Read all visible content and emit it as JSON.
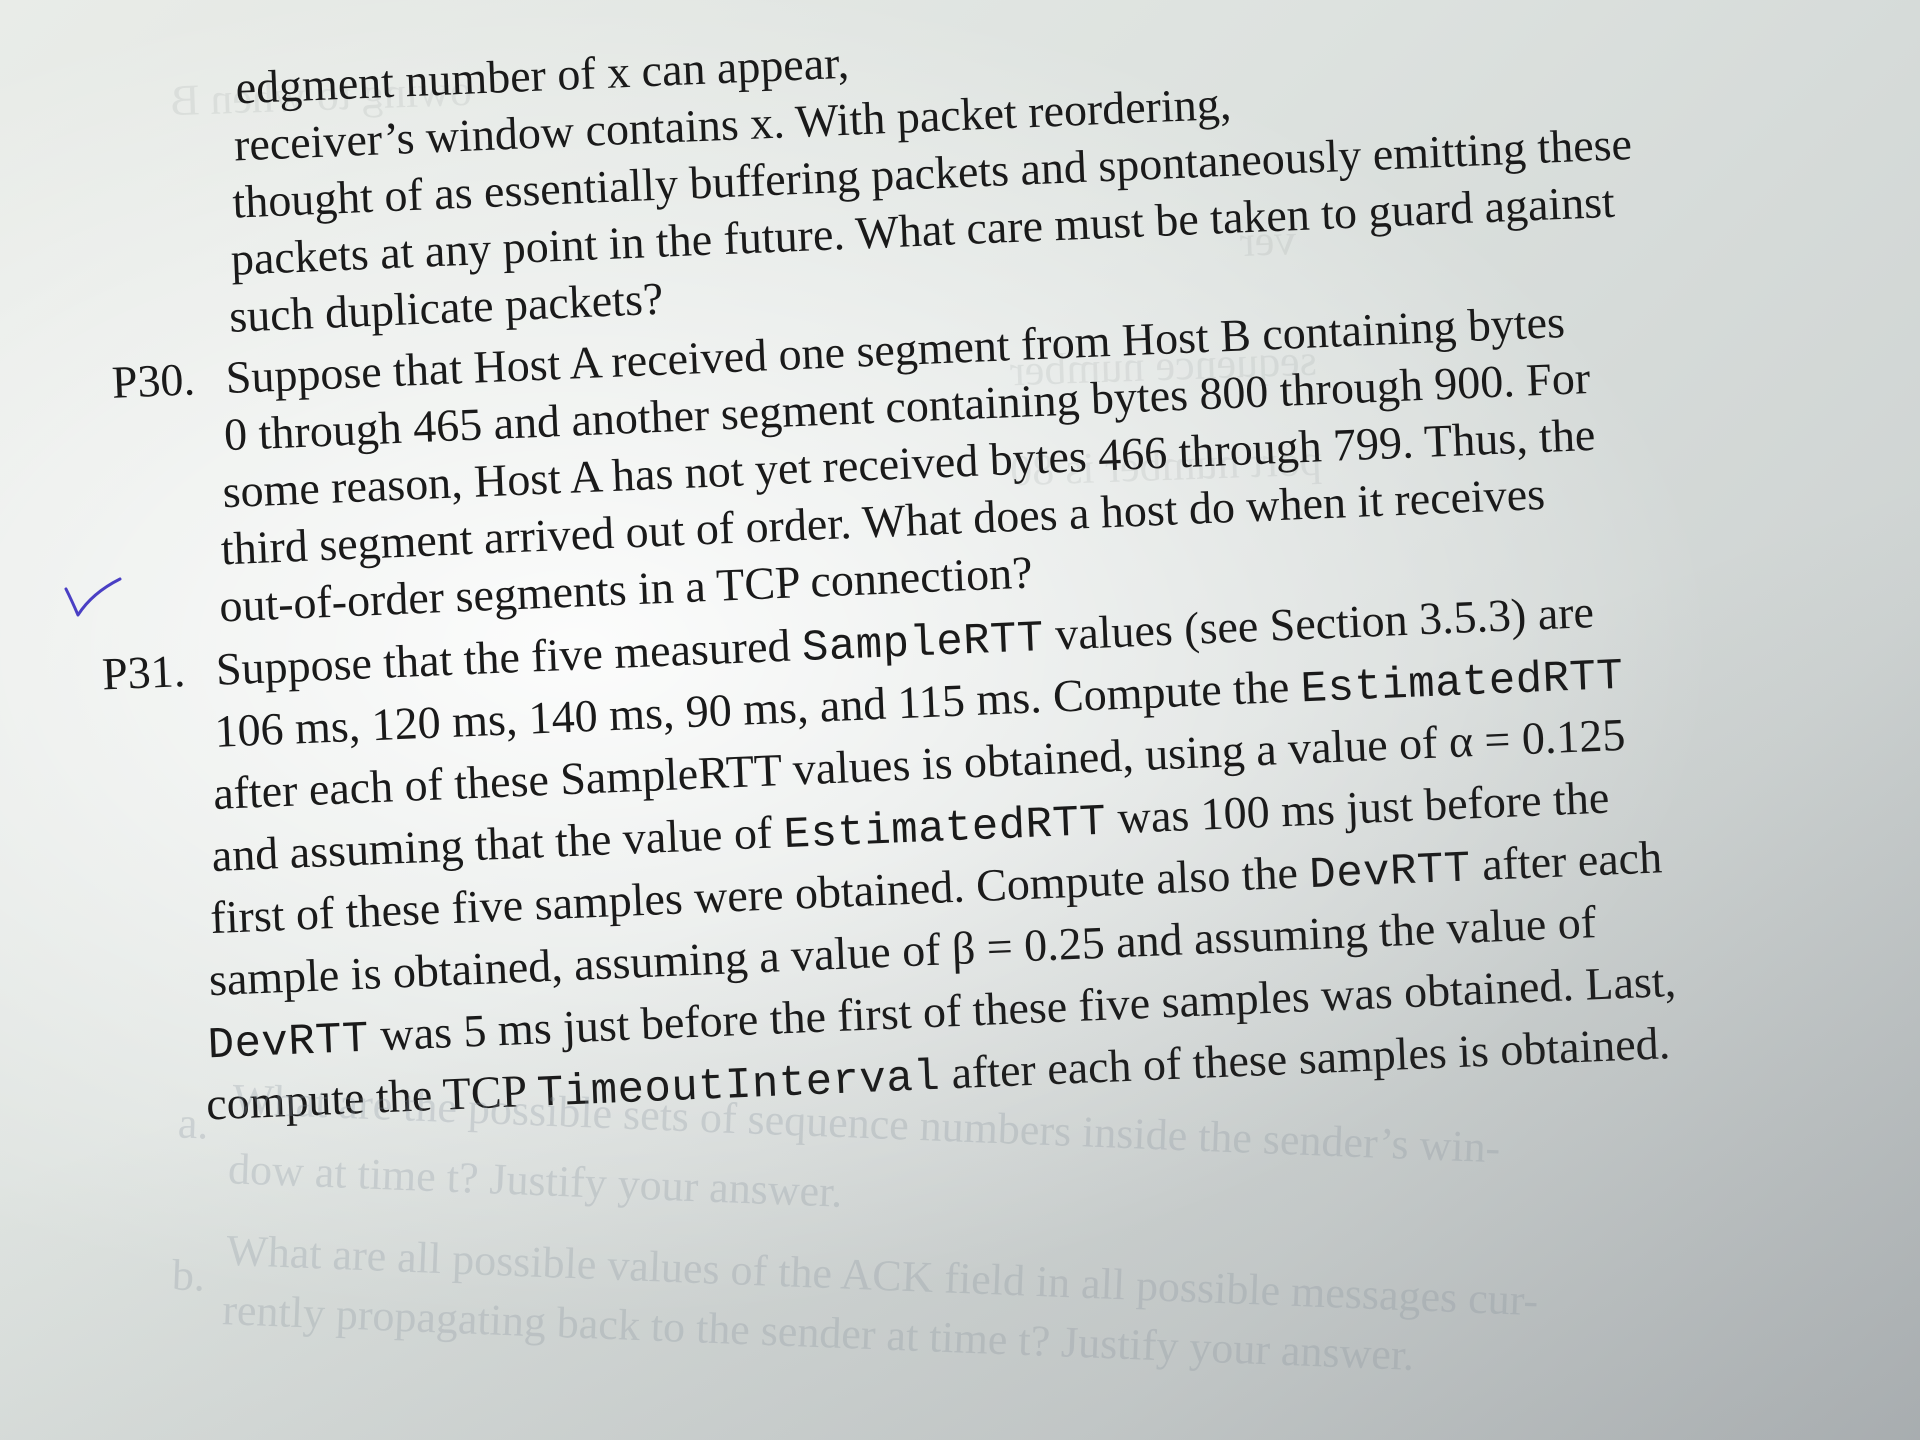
{
  "prev_problem": {
    "lines": [
      "edgment number of x can appear,",
      "receiver’s window contains x. With packet reordering,",
      "thought of as essentially buffering packets and spontaneously emitting these",
      "packets at any point in the future. What care must be taken to guard against",
      "such duplicate packets?"
    ]
  },
  "p30": {
    "number": "P30.",
    "lines": [
      "Suppose that Host A received one segment from Host B containing bytes",
      "0 through 465 and another segment containing bytes 800 through 900. For",
      "some reason, Host A has not yet received bytes 466 through 799. Thus, the",
      "third segment arrived out of order. What does a host do when it receives",
      "out-of-order segments in a TCP connection?"
    ]
  },
  "p31": {
    "number": "P31.",
    "line1_a": "Suppose that the five measured ",
    "line1_code": "SampleRTT",
    "line1_b": " values (see Section 3.5.3) are",
    "line2_a": "106 ms, 120 ms, 140 ms, 90 ms, and 115 ms. Compute the ",
    "line2_code": "EstimatedRTT",
    "line3": "after each of these SampleRTT values is obtained, using a value of α = 0.125",
    "line4_a": "and assuming that the value of ",
    "line4_code": "EstimatedRTT",
    "line4_b": " was 100 ms just before the",
    "line5_a": "first of these five samples were obtained. Compute also the ",
    "line5_code": "DevRTT",
    "line5_b": " after each",
    "line6": "sample is obtained, assuming a value of β = 0.25 and assuming the value of",
    "line7_code": "DevRTT",
    "line7_b": " was 5 ms just before the first of these five samples was obtained. Last,",
    "line8_a": "compute the TCP ",
    "line8_code": "TimeoutInterval",
    "line8_b": " after each of these samples is obtained."
  },
  "faded_parts": {
    "a_label": "a.",
    "a_line1": "What are the possible sets of sequence numbers inside the sender’s win-",
    "a_line2": "dow at time t? Justify your answer.",
    "b_label": "b.",
    "b_line1": "What are all possible values of the ACK field in all possible messages cur-",
    "b_line2": "rently propagating back to the sender at time t? Justify your answer."
  },
  "colors": {
    "ink": "#1a1a1a",
    "checkmark": "#4a3fc4",
    "paper": "#e4e8e5"
  }
}
